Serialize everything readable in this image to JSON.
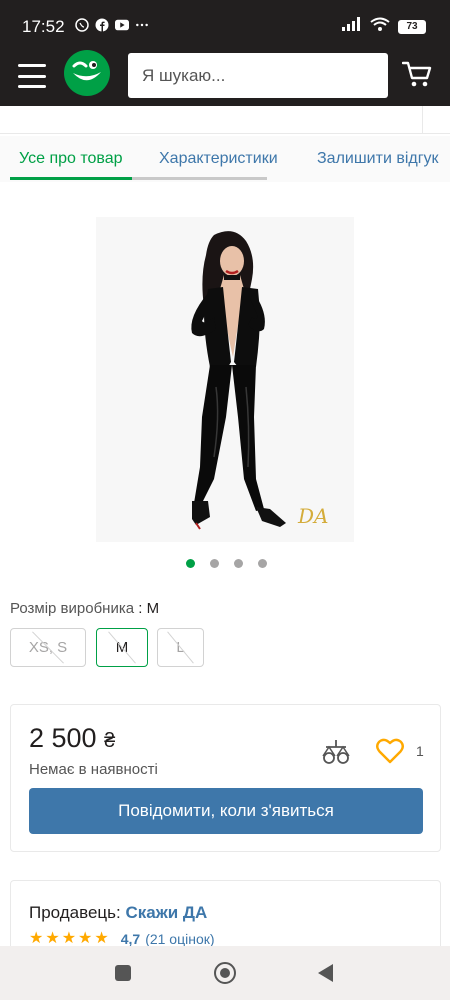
{
  "status_bar": {
    "time": "17:52",
    "battery": "73"
  },
  "header": {
    "search_placeholder": "Я шукаю..."
  },
  "tabs": [
    {
      "label": "Усе про товар",
      "active": true
    },
    {
      "label": "Характеристики",
      "active": false
    },
    {
      "label": "Залишити відгук",
      "active": false
    }
  ],
  "gallery": {
    "total": 4,
    "active_index": 0
  },
  "size": {
    "label": "Розмір виробника",
    "selected": "M",
    "options": [
      {
        "label": "XS, S",
        "available": false
      },
      {
        "label": "M",
        "available": false,
        "selected": true
      },
      {
        "label": "L",
        "available": false
      }
    ]
  },
  "price_card": {
    "price": "2 500",
    "currency": "₴",
    "availability": "Немає в наявності",
    "wishlist_count": "1",
    "notify_button": "Повідомити, коли з'явиться"
  },
  "seller": {
    "prefix": "Продавець: ",
    "name": "Скажи ДА",
    "rating_value": "4,7",
    "rating_count": "(21 оцінок)",
    "stars": 5
  },
  "colors": {
    "accent_green": "#00a046",
    "link_blue": "#3e77aa",
    "header_dark": "#221f1f",
    "star": "#ffa900"
  }
}
